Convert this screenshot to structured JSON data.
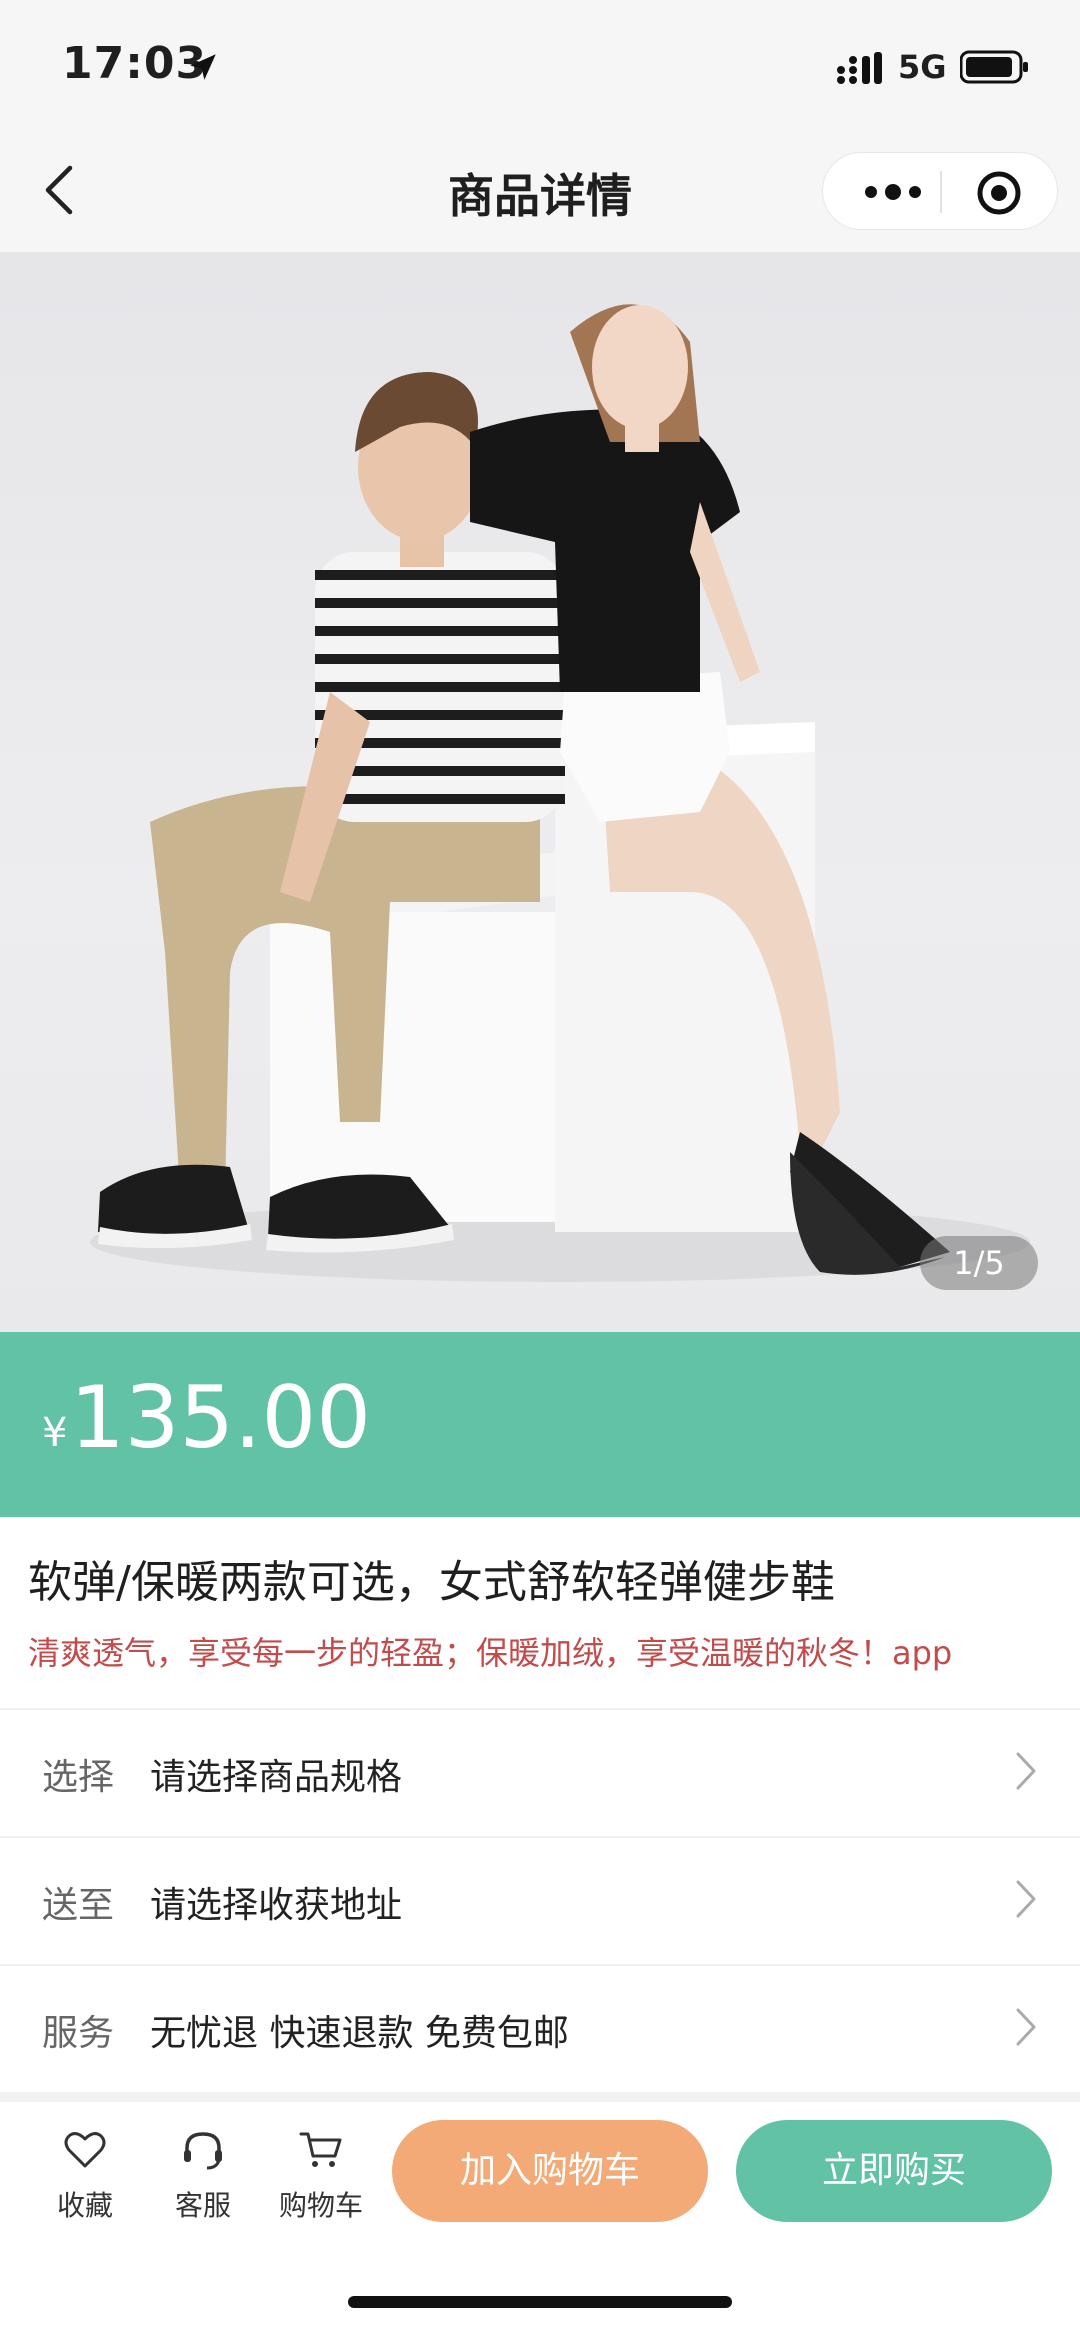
{
  "status_bar": {
    "time": "17:03",
    "network": "5G"
  },
  "nav": {
    "title": "商品详情"
  },
  "gallery": {
    "indicator": "1/5",
    "current": 1,
    "total": 5
  },
  "price": {
    "currency": "¥",
    "amount": "135.00"
  },
  "product": {
    "title": "软弹/保暖两款可选，女式舒软轻弹健步鞋",
    "subtitle": "清爽透气，享受每一步的轻盈；保暖加绒，享受温暖的秋冬！app"
  },
  "options": [
    {
      "label": "选择",
      "value": "请选择商品规格"
    },
    {
      "label": "送至",
      "value": "请选择收获地址"
    },
    {
      "label": "服务",
      "value": "无忧退 快速退款 免费包邮"
    }
  ],
  "bottom_bar": {
    "favorite_label": "收藏",
    "service_label": "客服",
    "cart_label": "购物车",
    "add_to_cart_label": "加入购物车",
    "buy_now_label": "立即购买"
  },
  "colors": {
    "accent_green": "#62c2a6",
    "accent_orange": "#f3aa76",
    "subtitle_red": "#c24c4c"
  },
  "icons": [
    "location-arrow-icon",
    "signal-icon",
    "battery-icon",
    "back-icon",
    "more-icon",
    "close-miniprogram-icon",
    "chevron-right-icon",
    "heart-icon",
    "headset-icon",
    "cart-icon"
  ]
}
